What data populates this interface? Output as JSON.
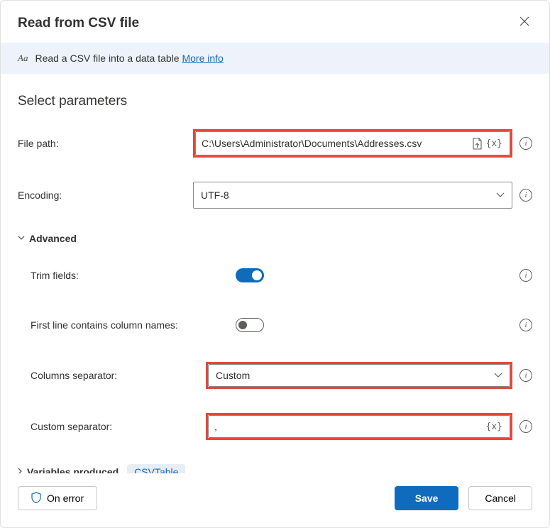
{
  "dialog": {
    "title": "Read from CSV file"
  },
  "info": {
    "text": "Read a CSV file into a data table ",
    "link_label": "More info"
  },
  "section": {
    "title": "Select parameters"
  },
  "fields": {
    "file_path_label": "File path:",
    "file_path_value": "C:\\Users\\Administrator\\Documents\\Addresses.csv",
    "encoding_label": "Encoding:",
    "encoding_value": "UTF-8",
    "advanced_label": "Advanced",
    "trim_label": "Trim fields:",
    "first_line_label": "First line contains column names:",
    "columns_sep_label": "Columns separator:",
    "columns_sep_value": "Custom",
    "custom_sep_label": "Custom separator:",
    "custom_sep_value": ","
  },
  "variables": {
    "label": "Variables produced",
    "badge": "CSVTable"
  },
  "buttons": {
    "on_error": "On error",
    "save": "Save",
    "cancel": "Cancel"
  },
  "icons": {
    "var": "{x}"
  }
}
